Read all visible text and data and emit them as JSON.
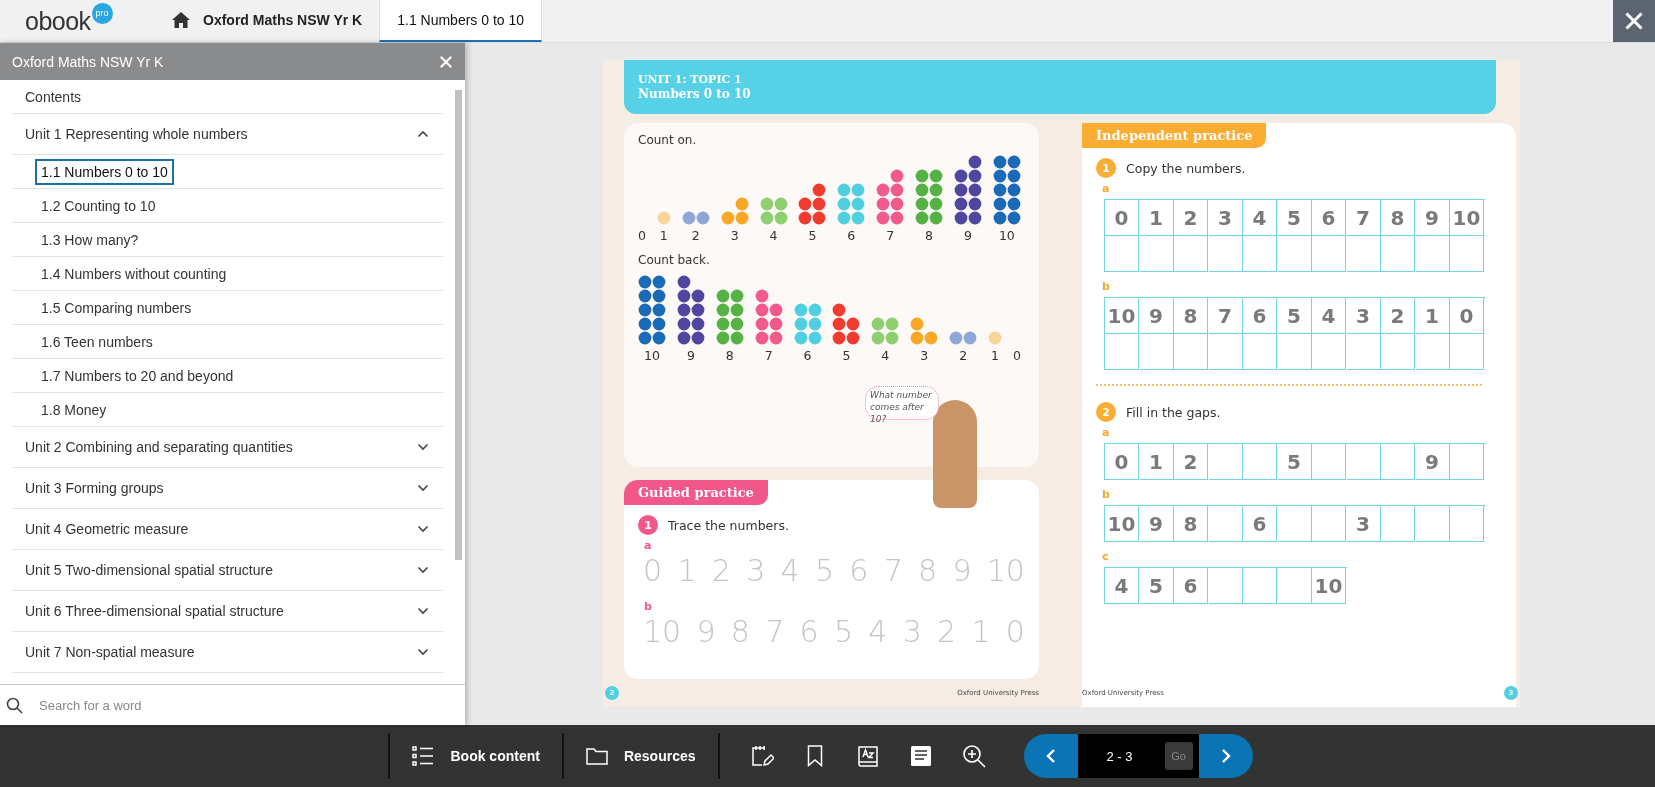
{
  "header": {
    "logo": "obook",
    "logo_badge": "pro",
    "tabs": [
      {
        "label": "Oxford Maths NSW Yr K",
        "kind": "home",
        "selected": false
      },
      {
        "label": "1.1 Numbers 0 to 10",
        "kind": "page",
        "selected": true
      }
    ]
  },
  "sidebar": {
    "title": "Oxford Maths NSW Yr K",
    "items": [
      {
        "label": "Contents",
        "kind": "link"
      },
      {
        "label": "Unit 1 Representing whole numbers",
        "kind": "unit",
        "expanded": true,
        "children": [
          {
            "label": "1.1 Numbers 0 to 10",
            "selected": true
          },
          {
            "label": "1.2 Counting to 10",
            "selected": false
          },
          {
            "label": "1.3 How many?",
            "selected": false
          },
          {
            "label": "1.4 Numbers without counting",
            "selected": false
          },
          {
            "label": "1.5 Comparing numbers",
            "selected": false
          },
          {
            "label": "1.6 Teen numbers",
            "selected": false
          },
          {
            "label": "1.7 Numbers to 20 and beyond",
            "selected": false
          },
          {
            "label": "1.8 Money",
            "selected": false
          }
        ]
      },
      {
        "label": "Unit 2 Combining and separating quantities",
        "kind": "unit",
        "expanded": false
      },
      {
        "label": "Unit 3 Forming groups",
        "kind": "unit",
        "expanded": false
      },
      {
        "label": "Unit 4 Geometric measure",
        "kind": "unit",
        "expanded": false
      },
      {
        "label": "Unit 5 Two-dimensional spatial structure",
        "kind": "unit",
        "expanded": false
      },
      {
        "label": "Unit 6 Three-dimensional spatial structure",
        "kind": "unit",
        "expanded": false
      },
      {
        "label": "Unit 7 Non-spatial measure",
        "kind": "unit",
        "expanded": false
      }
    ],
    "search": {
      "placeholder": "Search for a word"
    }
  },
  "book": {
    "banner": {
      "eyebrow": "UNIT 1: TOPIC 1",
      "title": "Numbers 0 to 10"
    },
    "left_page": {
      "count_on": {
        "title": "Count on.",
        "groups": [
          {
            "label": "0"
          },
          {
            "label": "1",
            "color": "#f6d49a"
          },
          {
            "label": "2",
            "color": "#8fa6d8"
          },
          {
            "label": "3",
            "color": "#f9a826"
          },
          {
            "label": "4",
            "color": "#8fcf72"
          },
          {
            "label": "5",
            "color": "#f23b30"
          },
          {
            "label": "6",
            "color": "#4fcfe0"
          },
          {
            "label": "7",
            "color": "#f25a8e"
          },
          {
            "label": "8",
            "color": "#55b345"
          },
          {
            "label": "9",
            "color": "#4f46a0"
          },
          {
            "label": "10",
            "color": "#1a6ab8"
          }
        ]
      },
      "count_back": {
        "title": "Count back.",
        "groups": [
          {
            "label": "10",
            "color": "#1a6ab8"
          },
          {
            "label": "9",
            "color": "#4f46a0"
          },
          {
            "label": "8",
            "color": "#55b345"
          },
          {
            "label": "7",
            "color": "#f25a8e"
          },
          {
            "label": "6",
            "color": "#4fcfe0"
          },
          {
            "label": "5",
            "color": "#f23b30"
          },
          {
            "label": "4",
            "color": "#8fcf72"
          },
          {
            "label": "3",
            "color": "#f9a826"
          },
          {
            "label": "2",
            "color": "#8fa6d8"
          },
          {
            "label": "1",
            "color": "#f6d49a"
          },
          {
            "label": "0"
          }
        ]
      },
      "speech_bubble": "What number comes after 10?",
      "guided_practice": {
        "tag": "Guided practice",
        "number": "1",
        "instruction": "Trace the numbers.",
        "parts": [
          {
            "letter": "a",
            "numerals": [
              "0",
              "1",
              "2",
              "3",
              "4",
              "5",
              "6",
              "7",
              "8",
              "9",
              "10"
            ]
          },
          {
            "letter": "b",
            "numerals": [
              "10",
              "9",
              "8",
              "7",
              "6",
              "5",
              "4",
              "3",
              "2",
              "1",
              "0"
            ]
          }
        ]
      },
      "page_number": "2",
      "publisher": "Oxford University Press"
    },
    "right_page": {
      "tag": "Independent practice",
      "questions": [
        {
          "number": "1",
          "instruction": "Copy the numbers.",
          "parts": [
            {
              "letter": "a",
              "rows": [
                [
                  "0",
                  "1",
                  "2",
                  "3",
                  "4",
                  "5",
                  "6",
                  "7",
                  "8",
                  "9",
                  "10"
                ],
                [
                  null,
                  null,
                  null,
                  null,
                  null,
                  null,
                  null,
                  null,
                  null,
                  null,
                  null
                ]
              ]
            },
            {
              "letter": "b",
              "rows": [
                [
                  "10",
                  "9",
                  "8",
                  "7",
                  "6",
                  "5",
                  "4",
                  "3",
                  "2",
                  "1",
                  "0"
                ],
                [
                  null,
                  null,
                  null,
                  null,
                  null,
                  null,
                  null,
                  null,
                  null,
                  null,
                  null
                ]
              ]
            }
          ]
        },
        {
          "number": "2",
          "instruction": "Fill in the gaps.",
          "parts": [
            {
              "letter": "a",
              "rows": [
                [
                  "0",
                  "1",
                  "2",
                  null,
                  null,
                  "5",
                  null,
                  null,
                  null,
                  "9",
                  null
                ]
              ]
            },
            {
              "letter": "b",
              "rows": [
                [
                  "10",
                  "9",
                  "8",
                  null,
                  "6",
                  null,
                  null,
                  "3",
                  null,
                  null,
                  null
                ]
              ]
            },
            {
              "letter": "c",
              "rows": [
                [
                  "4",
                  "5",
                  "6",
                  null,
                  null,
                  null,
                  "10"
                ]
              ]
            }
          ]
        }
      ],
      "publisher": "Oxford University Press",
      "page_number": "3"
    }
  },
  "toolbar": {
    "buttons": [
      {
        "label": "Book content",
        "kind": "list"
      },
      {
        "label": "Resources",
        "kind": "folder"
      }
    ],
    "tools": [
      {
        "kind": "notes"
      },
      {
        "kind": "bookmark"
      },
      {
        "kind": "glossary"
      },
      {
        "kind": "page"
      },
      {
        "kind": "zoom"
      }
    ],
    "pager": {
      "value": "2 - 3",
      "go": "Go"
    }
  }
}
